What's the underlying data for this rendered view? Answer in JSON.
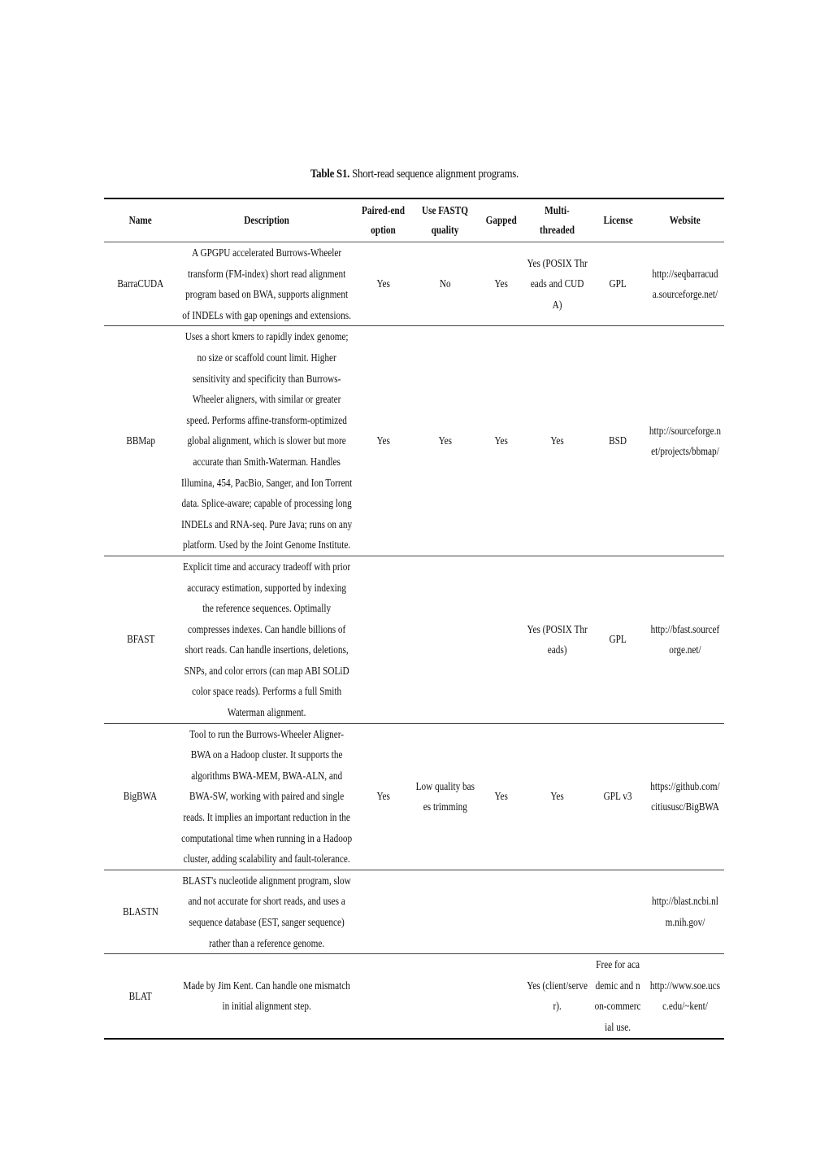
{
  "caption": {
    "label": "Table S1.",
    "text": "Short-read sequence alignment programs."
  },
  "table": {
    "headers": {
      "name": "Name",
      "description": "Description",
      "paired_end": "Paired-end option",
      "fastq": "Use FASTQ quality",
      "gapped": "Gapped",
      "multithreaded": "Multi-threaded",
      "license": "License",
      "website": "Website"
    },
    "rows": [
      {
        "name": "BarraCUDA",
        "description": "A GPGPU accelerated Burrows-Wheeler transform (FM-index) short read alignment program based on BWA, supports alignment of INDELs with gap openings and extensions.",
        "paired_end": "Yes",
        "fastq": "No",
        "gapped": "Yes",
        "multithreaded": "Yes (POSIX Threads and CUDA)",
        "license": "GPL",
        "website": "http://seqbarracuda.sourceforge.net/"
      },
      {
        "name": "BBMap",
        "description": "Uses a short kmers to rapidly index genome; no size or scaffold count limit. Higher sensitivity and specificity than Burrows-Wheeler aligners, with similar or greater speed. Performs affine-transform-optimized global alignment, which is slower but more accurate than Smith-Waterman. Handles Illumina, 454, PacBio, Sanger, and Ion Torrent data. Splice-aware; capable of processing long INDELs and RNA-seq. Pure Java; runs on any platform. Used by the Joint Genome Institute.",
        "paired_end": "Yes",
        "fastq": "Yes",
        "gapped": "Yes",
        "multithreaded": "Yes",
        "license": "BSD",
        "website": "http://sourceforge.net/projects/bbmap/"
      },
      {
        "name": "BFAST",
        "description": "Explicit time and accuracy tradeoff with prior accuracy estimation, supported by indexing the reference sequences. Optimally compresses indexes. Can handle billions of short reads. Can handle insertions, deletions, SNPs, and color errors (can map ABI SOLiD color space reads). Performs a full Smith Waterman alignment.",
        "paired_end": "",
        "fastq": "",
        "gapped": "",
        "multithreaded": "Yes (POSIX Threads)",
        "license": "GPL",
        "website": "http://bfast.sourceforge.net/"
      },
      {
        "name": "BigBWA",
        "description": "Tool to run the Burrows-Wheeler Aligner-BWA on a Hadoop cluster. It supports the algorithms BWA-MEM, BWA-ALN, and BWA-SW, working with paired and single reads. It implies an important reduction in the computational time when running in a Hadoop cluster, adding scalability and fault-tolerance.",
        "paired_end": "Yes",
        "fastq": "Low quality bases trimming",
        "gapped": "Yes",
        "multithreaded": "Yes",
        "license": "GPL v3",
        "website": "https://github.com/citiususc/BigBWA"
      },
      {
        "name": "BLASTN",
        "description": "BLAST's nucleotide alignment program, slow and not accurate for short reads, and uses a sequence database (EST, sanger sequence) rather than a reference genome.",
        "paired_end": "",
        "fastq": "",
        "gapped": "",
        "multithreaded": "",
        "license": "",
        "website": "http://blast.ncbi.nlm.nih.gov/"
      },
      {
        "name": "BLAT",
        "description": "Made by Jim Kent. Can handle one mismatch in initial alignment step.",
        "paired_end": "",
        "fastq": "",
        "gapped": "",
        "multithreaded": "Yes (client/server).",
        "license": "Free for academic and non-commercial use.",
        "website": "http://www.soe.ucsc.edu/~kent/"
      }
    ]
  }
}
